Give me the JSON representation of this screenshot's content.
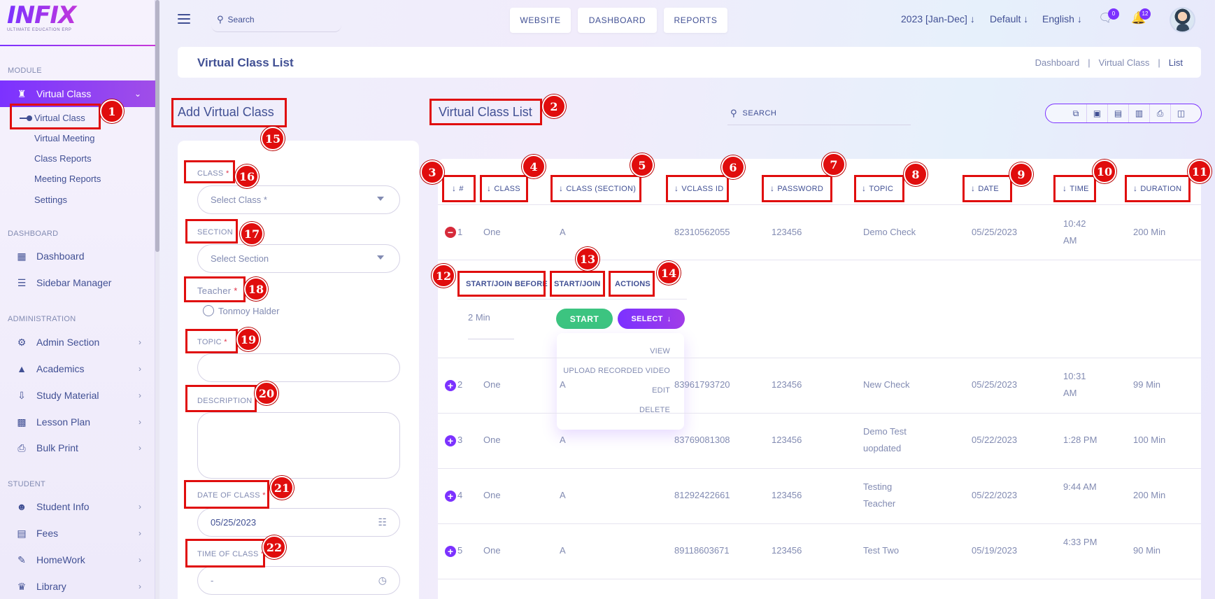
{
  "brand": {
    "name": "INFIX",
    "tagline": "ULTIMATE EDUCATION ERP"
  },
  "sidebar": {
    "sections": {
      "module": "MODULE",
      "dashboard": "DASHBOARD",
      "administration": "ADMINISTRATION",
      "student": "STUDENT"
    },
    "virtual_class": {
      "label": "Virtual Class",
      "icon": "virtual-class-icon"
    },
    "sub_items": [
      "Virtual Class",
      "Virtual Meeting",
      "Class Reports",
      "Meeting Reports",
      "Settings"
    ],
    "dashboard_items": [
      "Dashboard",
      "Sidebar Manager"
    ],
    "admin_items": [
      "Admin Section",
      "Academics",
      "Study Material",
      "Lesson Plan",
      "Bulk Print"
    ],
    "student_items": [
      "Student Info",
      "Fees",
      "HomeWork",
      "Library"
    ]
  },
  "topbar": {
    "search_placeholder": "Search",
    "buttons": [
      "WEBSITE",
      "DASHBOARD",
      "REPORTS"
    ],
    "session": "2023 [Jan-Dec]",
    "style": "Default",
    "language": "English",
    "chat_badge": "0",
    "notification_badge": "12"
  },
  "header": {
    "title": "Virtual Class List",
    "breadcrumbs": [
      "Dashboard",
      "Virtual Class",
      "List"
    ]
  },
  "form": {
    "title": "Add Virtual Class",
    "class_label": "CLASS",
    "class_placeholder": "Select Class *",
    "section_label": "SECTION",
    "section_placeholder": "Select Section",
    "teacher_label": "Teacher",
    "teacher_option": "Tonmoy Halder",
    "topic_label": "TOPIC",
    "description_label": "DESCRIPTION",
    "date_label": "DATE OF CLASS",
    "date_value": "05/25/2023",
    "time_label": "TIME OF CLASS",
    "time_value": "-",
    "required_mark": "*"
  },
  "list": {
    "title": "Virtual Class List",
    "search_placeholder": "SEARCH",
    "columns": [
      "#",
      "CLASS",
      "CLASS (SECTION)",
      "VCLASS ID",
      "PASSWORD",
      "TOPIC",
      "DATE",
      "TIME",
      "DURATION"
    ],
    "rows": [
      {
        "n": "1",
        "cls": "One",
        "section": "A",
        "vclass_id": "82310562055",
        "password": "123456",
        "topic": "Demo Check",
        "date": "05/25/2023",
        "time": "10:42 AM",
        "duration": "200 Min"
      },
      {
        "n": "2",
        "cls": "One",
        "section": "A",
        "vclass_id": "83961793720",
        "password": "123456",
        "topic": "New Check",
        "date": "05/25/2023",
        "time": "10:31 AM",
        "duration": "99 Min"
      },
      {
        "n": "3",
        "cls": "One",
        "section": "A",
        "vclass_id": "83769081308",
        "password": "123456",
        "topic": "Demo Test uopdated",
        "date": "05/22/2023",
        "time": "1:28 PM",
        "duration": "100 Min"
      },
      {
        "n": "4",
        "cls": "One",
        "section": "A",
        "vclass_id": "81292422661",
        "password": "123456",
        "topic": "Testing Teacher",
        "date": "05/22/2023",
        "time": "9:44 AM",
        "duration": "200 Min"
      },
      {
        "n": "5",
        "cls": "One",
        "section": "A",
        "vclass_id": "89118603671",
        "password": "123456",
        "topic": "Test Two",
        "date": "05/19/2023",
        "time": "4:33 PM",
        "duration": "90 Min"
      }
    ],
    "child_columns": [
      "START/JOIN BEFORE",
      "START/JOIN",
      "ACTIONS"
    ],
    "child_duration": "2 Min",
    "start_label": "START",
    "select_label": "SELECT",
    "actions_menu": [
      "VIEW",
      "UPLOAD RECORDED VIDEO",
      "EDIT",
      "DELETE"
    ]
  },
  "annotations": [
    "1",
    "2",
    "3",
    "4",
    "5",
    "6",
    "7",
    "8",
    "9",
    "10",
    "11",
    "12",
    "13",
    "14",
    "15",
    "16",
    "17",
    "18",
    "19",
    "20",
    "21",
    "22"
  ],
  "colors": {
    "accent": "#7c32ff",
    "text": "#415094",
    "muted": "#828bb2",
    "success": "#3cc480",
    "annotation": "#e00d0d"
  }
}
